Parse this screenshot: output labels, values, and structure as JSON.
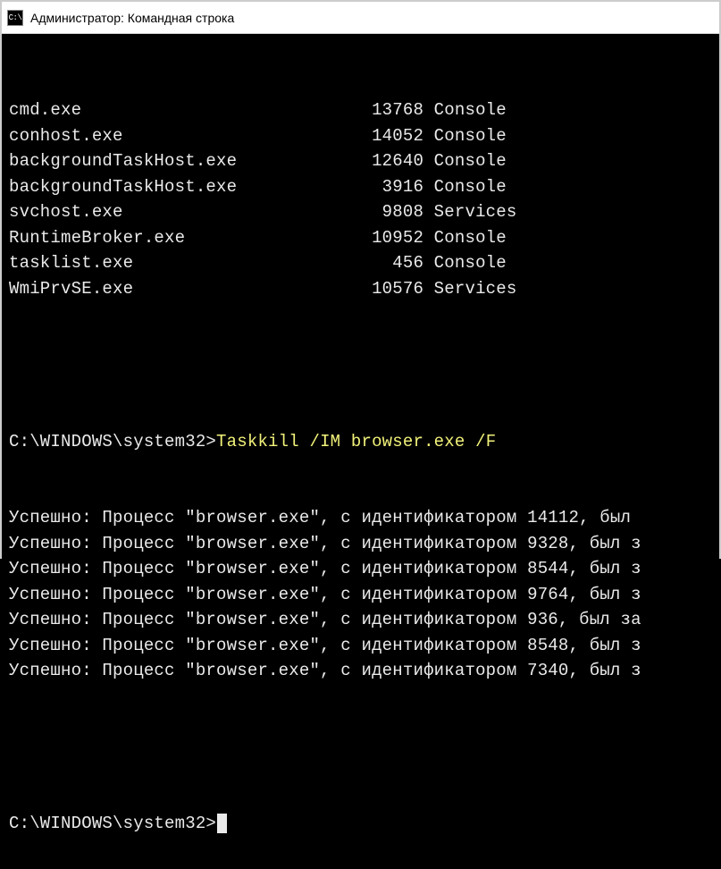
{
  "window": {
    "icon_label": "C:\\",
    "title": "Администратор: Командная строка"
  },
  "processes": [
    {
      "name": "cmd.exe",
      "pid": "13768",
      "session": "Console"
    },
    {
      "name": "conhost.exe",
      "pid": "14052",
      "session": "Console"
    },
    {
      "name": "backgroundTaskHost.exe",
      "pid": "12640",
      "session": "Console"
    },
    {
      "name": "backgroundTaskHost.exe",
      "pid": "3916",
      "session": "Console"
    },
    {
      "name": "svchost.exe",
      "pid": "9808",
      "session": "Services"
    },
    {
      "name": "RuntimeBroker.exe",
      "pid": "10952",
      "session": "Console"
    },
    {
      "name": "tasklist.exe",
      "pid": "456",
      "session": "Console"
    },
    {
      "name": "WmiPrvSE.exe",
      "pid": "10576",
      "session": "Services"
    }
  ],
  "prompt1": {
    "path": "C:\\WINDOWS\\system32>",
    "command": "Taskkill /IM browser.exe /F"
  },
  "kill_results": [
    {
      "prefix": "Успешно: Процесс \"browser.exe\", с идентификатором",
      "pid": "14112,",
      "suffix": "был "
    },
    {
      "prefix": "Успешно: Процесс \"browser.exe\", с идентификатором",
      "pid": "9328,",
      "suffix": "был з"
    },
    {
      "prefix": "Успешно: Процесс \"browser.exe\", с идентификатором",
      "pid": "8544,",
      "suffix": "был з"
    },
    {
      "prefix": "Успешно: Процесс \"browser.exe\", с идентификатором",
      "pid": "9764,",
      "suffix": "был з"
    },
    {
      "prefix": "Успешно: Процесс \"browser.exe\", с идентификатором",
      "pid": "936,",
      "suffix": "был за"
    },
    {
      "prefix": "Успешно: Процесс \"browser.exe\", с идентификатором",
      "pid": "8548,",
      "suffix": "был з"
    },
    {
      "prefix": "Успешно: Процесс \"browser.exe\", с идентификатором",
      "pid": "7340,",
      "suffix": "был з"
    }
  ],
  "prompt2": {
    "path": "C:\\WINDOWS\\system32>"
  },
  "layout": {
    "name_width": 30,
    "pid_width": 10
  }
}
